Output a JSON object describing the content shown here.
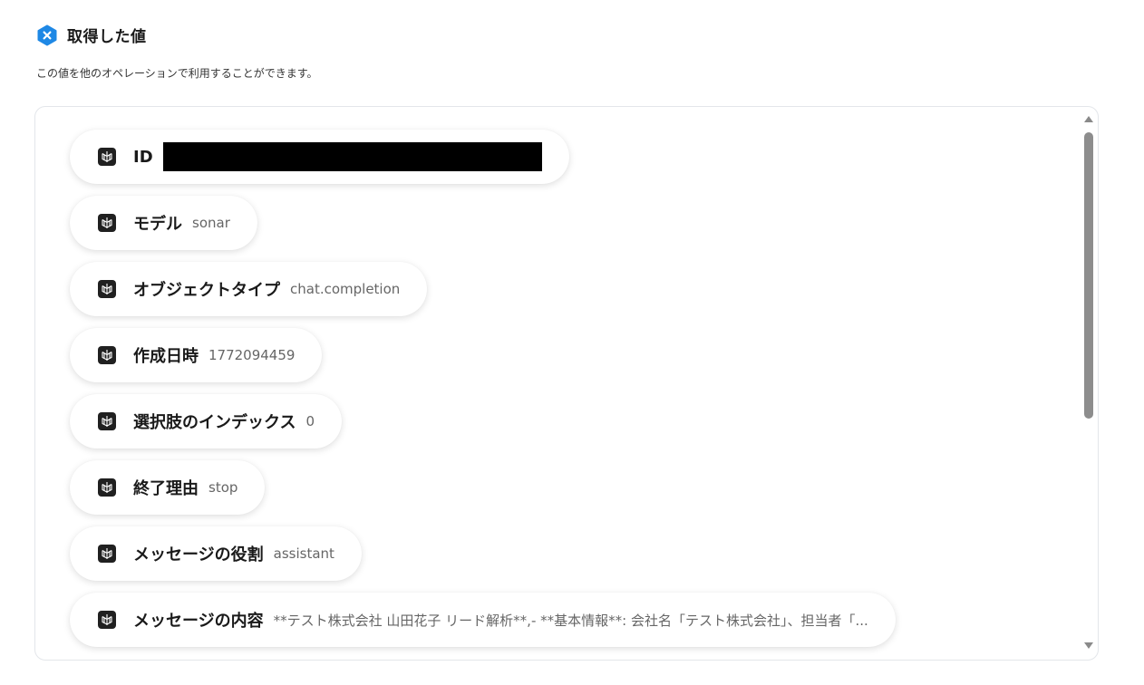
{
  "header": {
    "title": "取得した値",
    "subtitle": "この値を他のオペレーションで利用することができます。",
    "icon": "x-hexagon-icon",
    "accent": "#1e88e5"
  },
  "items": [
    {
      "label": "ID",
      "value": "",
      "redacted": true
    },
    {
      "label": "モデル",
      "value": "sonar"
    },
    {
      "label": "オブジェクトタイプ",
      "value": "chat.completion"
    },
    {
      "label": "作成日時",
      "value": "1772094459"
    },
    {
      "label": "選択肢のインデックス",
      "value": "0"
    },
    {
      "label": "終了理由",
      "value": "stop"
    },
    {
      "label": "メッセージの役割",
      "value": "assistant"
    },
    {
      "label": "メッセージの内容",
      "value": "**テスト株式会社 山田花子 リード解析**,- **基本情報**: 会社名「テスト株式会社」、担当者「..."
    }
  ],
  "item_icon": "perplexity-icon"
}
